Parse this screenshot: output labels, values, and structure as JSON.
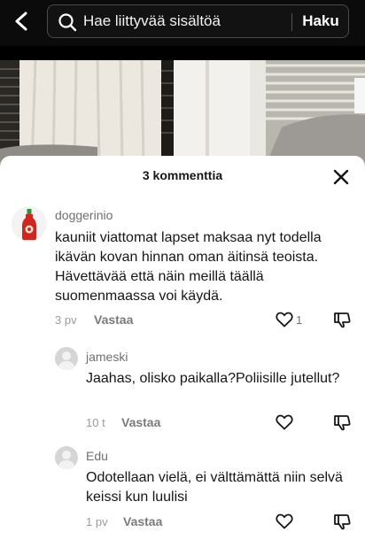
{
  "search": {
    "placeholder": "Hae liittyvää sisältöä",
    "button_label": "Haku"
  },
  "comments_panel": {
    "title": "3 kommenttia"
  },
  "comments": [
    {
      "username": "doggerinio",
      "text": "kauniit viattomat lapset maksaa nyt todella ikävän kovan hinnan oman äitinsä teoista. Hävettävää että näin meillä täällä suomenmaassa voi käydä.",
      "time": "3 pv",
      "reply_label": "Vastaa",
      "likes": "1"
    },
    {
      "username": "jameski",
      "text": "Jaahas, olisko paikalla?Poliisille jutellut?",
      "time": "10 t",
      "reply_label": "Vastaa"
    },
    {
      "username": "Edu",
      "text": "Odotellaan vielä, ei välttämättä niin selvä keissi kun luulisi",
      "time": "1 pv",
      "reply_label": "Vastaa"
    }
  ],
  "icons": {
    "back": "chevron-left-icon",
    "search": "search-icon",
    "close": "close-icon",
    "like": "heart-icon",
    "dislike": "thumbs-down-icon",
    "avatar_1": "sriracha-bottle-avatar",
    "avatar_default": "default-avatar"
  },
  "colors": {
    "topbar_bg": "#0b0b0b",
    "sheet_bg": "#ffffff",
    "text_primary": "#161616",
    "text_secondary": "#6f6f6f",
    "bottle_red": "#d3251f",
    "bottle_cap": "#2f8f3a"
  }
}
